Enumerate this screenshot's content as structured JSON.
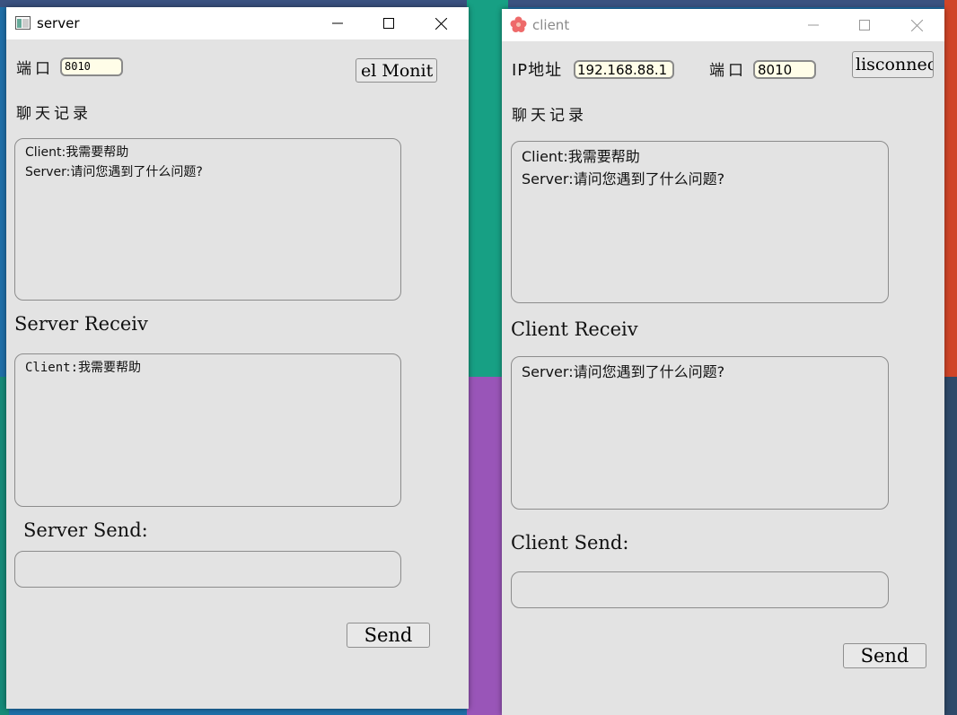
{
  "server": {
    "title": "server",
    "port_label": "端口",
    "port_value": "8010",
    "monitor_button": "el Monit",
    "history_label": "聊天记录",
    "history_lines": [
      "Client:我需要帮助",
      "Server:请问您遇到了什么问题?"
    ],
    "receive_label": "Server Receiv",
    "receive_lines": [
      "Client:我需要帮助"
    ],
    "send_label": "Server Send:",
    "send_value": "",
    "send_button": "Send"
  },
  "client": {
    "title": "client",
    "ip_label": "IP地址",
    "ip_value": "192.168.88.1",
    "port_label": "端口",
    "port_value": "8010",
    "disconnect_button": "lisconnec",
    "history_label": "聊天记录",
    "history_lines": [
      "Client:我需要帮助",
      "Server:请问您遇到了什么问题?"
    ],
    "receive_label": "Client Receiv",
    "receive_lines": [
      "Server:请问您遇到了什么问题?"
    ],
    "send_label": "Client Send:",
    "send_value": "",
    "send_button": "Send"
  }
}
